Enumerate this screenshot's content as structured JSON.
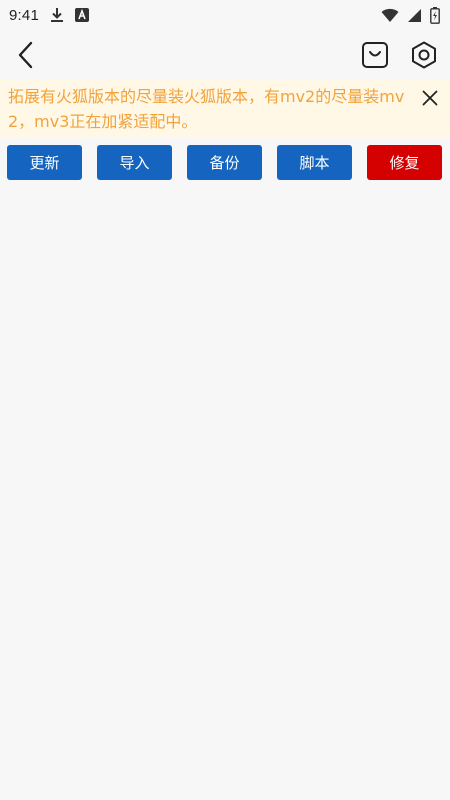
{
  "status_bar": {
    "time": "9:41",
    "icons": [
      "download-icon",
      "a-icon",
      "wifi-icon",
      "signal-icon",
      "battery-charging-icon"
    ]
  },
  "app_bar": {
    "icons": [
      "back-arrow-icon",
      "shopping-bag-icon",
      "hexagon-settings-icon"
    ]
  },
  "notice": {
    "text": "拓展有火狐版本的尽量装火狐版本，有mv2的尽量装mv2，mv3正在加紧适配中。",
    "close_icon": "close-icon",
    "text_color": "#f2a23a",
    "background": "#fff8e6"
  },
  "actions": {
    "update": "更新",
    "import": "导入",
    "backup": "备份",
    "script": "脚本",
    "repair": "修复"
  },
  "colors": {
    "primary": "#1565c0",
    "danger": "#d50000",
    "background": "#f7f7f7"
  }
}
